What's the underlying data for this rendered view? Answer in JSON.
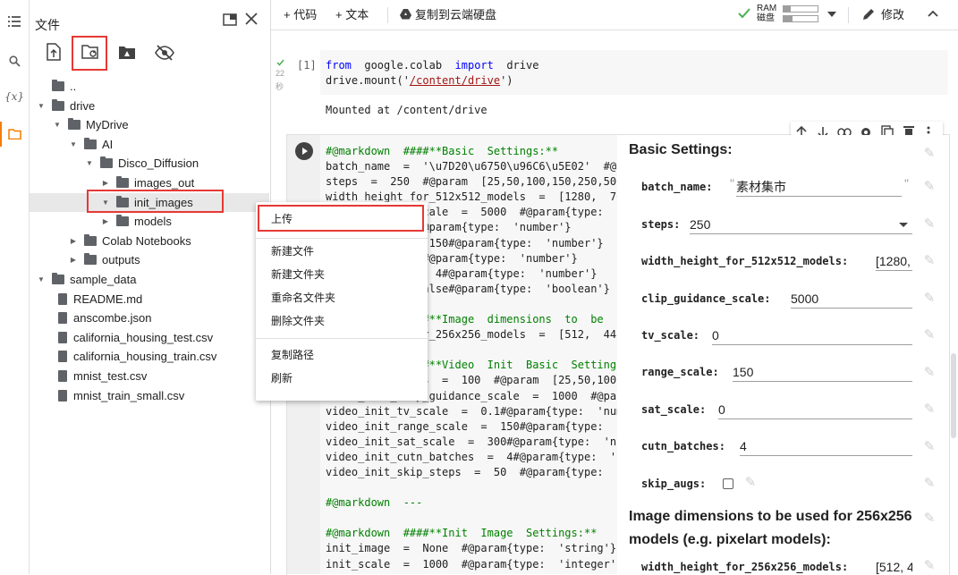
{
  "sidebar": {
    "title": "文件",
    "icons": [
      "toc-icon",
      "search-icon",
      "variables-icon",
      "folder-icon"
    ],
    "tree": [
      {
        "label": "..",
        "type": "up",
        "depth": 0
      },
      {
        "label": "drive",
        "type": "folder",
        "depth": 0,
        "open": true
      },
      {
        "label": "MyDrive",
        "type": "folder",
        "depth": 1,
        "open": true
      },
      {
        "label": "AI",
        "type": "folder",
        "depth": 2,
        "open": true
      },
      {
        "label": "Disco_Diffusion",
        "type": "folder",
        "depth": 3,
        "open": true
      },
      {
        "label": "images_out",
        "type": "folder",
        "depth": 4,
        "open": false
      },
      {
        "label": "init_images",
        "type": "folder",
        "depth": 4,
        "open": true,
        "selected": true
      },
      {
        "label": "models",
        "type": "folder",
        "depth": 4,
        "open": false
      },
      {
        "label": "Colab Notebooks",
        "type": "folder",
        "depth": 2,
        "open": false
      },
      {
        "label": "outputs",
        "type": "folder",
        "depth": 2,
        "open": false
      },
      {
        "label": "sample_data",
        "type": "folder",
        "depth": 0,
        "open": true
      },
      {
        "label": "README.md",
        "type": "file",
        "depth": 1
      },
      {
        "label": "anscombe.json",
        "type": "file",
        "depth": 1
      },
      {
        "label": "california_housing_test.csv",
        "type": "file",
        "depth": 1
      },
      {
        "label": "california_housing_train.csv",
        "type": "file",
        "depth": 1
      },
      {
        "label": "mnist_test.csv",
        "type": "file",
        "depth": 1
      },
      {
        "label": "mnist_train_small.csv",
        "type": "file",
        "depth": 1
      }
    ]
  },
  "toolbar": {
    "add_code": "+ 代码",
    "add_text": "+ 文本",
    "copy_drive": "复制到云端硬盘",
    "ram": "RAM",
    "disk": "磁盘",
    "edit": "修改"
  },
  "cell1": {
    "exec_count": "[1]",
    "duration_num": "22",
    "duration_unit": "秒",
    "line1_from": "from",
    "line1_mod": "google.colab",
    "line1_import": "import",
    "line1_name": "drive",
    "line2_pre": "drive.mount('",
    "line2_path": "/content/drive",
    "line2_post": "')",
    "output": "Mounted at /content/drive"
  },
  "cell2": {
    "code_lines": [
      "#@markdown  ####**Basic  Settings:**",
      "batch_name  =  '\\u7D20\\u6750\\u96C6\\u5E02'  #@p",
      "steps  =  250  #@param  [25,50,100,150,250,500,",
      "width_height_for_512x512_models  =  [1280,  76",
      "clip_guidance_scale  =  5000  #@param{type:  'n",
      "tv_scale  =  0#@param{type:  'number'}",
      "range_scale  =  150#@param{type:  'number'}",
      "sat_scale  =  0#@param{type:  'number'}",
      "cutn_batches  =  4#@param{type:  'number'}",
      "skip_augs  =  False#@param{type:  'boolean'}",
      "",
      "#@markdown  ####**Image  dimensions  to  be  us",
      "width_height_for_256x256_models  =  [512,  448]",
      "",
      "#@markdown  ####**Video  Init  Basic  Settings:",
      "video_init_steps  =  100  #@param  [25,50,100,1",
      "video_init_clip_guidance_scale  =  1000  #@par",
      "video_init_tv_scale  =  0.1#@param{type:  'numb",
      "video_init_range_scale  =  150#@param{type:  'n",
      "video_init_sat_scale  =  300#@param{type:  'nu",
      "video_init_cutn_batches  =  4#@param{type:  'n",
      "video_init_skip_steps  =  50  #@param{type:  ':",
      "",
      "#@markdown  ---",
      "",
      "#@markdown  ####**Init  Image  Settings:**",
      "init_image  =  None  #@param{type:  'string'}",
      "init_scale  =  1000  #@param{type:  'integer'}"
    ]
  },
  "form": {
    "heading": "Basic Settings:",
    "fields": [
      {
        "label": "batch_name:",
        "value": "素材集市"
      },
      {
        "label": "steps:",
        "value": "250"
      },
      {
        "label": "width_height_for_512x512_models:",
        "value": "[1280,"
      },
      {
        "label": "clip_guidance_scale:",
        "value": "5000"
      },
      {
        "label": "tv_scale:",
        "value": "0"
      },
      {
        "label": "range_scale:",
        "value": "150"
      },
      {
        "label": "sat_scale:",
        "value": "0"
      },
      {
        "label": "cutn_batches:",
        "value": "4"
      },
      {
        "label": "skip_augs:",
        "value": ""
      }
    ],
    "heading2_line1": "Image dimensions to be used for 256x256",
    "heading2_line2": "models (e.g. pixelart models):",
    "field_256_label": "width_height_for_256x256_models:",
    "field_256_value": "[512, 4"
  },
  "context_menu": {
    "items": [
      "上传",
      "新建文件",
      "新建文件夹",
      "重命名文件夹",
      "删除文件夹",
      "复制路径",
      "刷新"
    ]
  }
}
